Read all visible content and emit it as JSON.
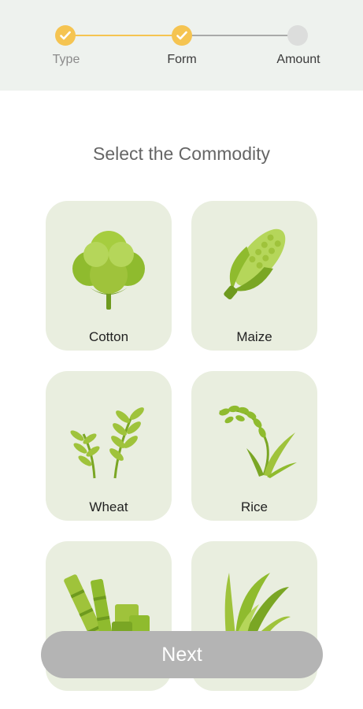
{
  "stepper": {
    "steps": [
      {
        "label": "Type",
        "status": "done"
      },
      {
        "label": "Form",
        "status": "done"
      },
      {
        "label": "Amount",
        "status": "pending"
      }
    ],
    "done_color": "#f5c451",
    "pending_color": "#dcdddc"
  },
  "page": {
    "title": "Select the Commodity"
  },
  "commodities": [
    {
      "label": "Cotton",
      "icon": "cotton-icon"
    },
    {
      "label": "Maize",
      "icon": "maize-icon"
    },
    {
      "label": "Wheat",
      "icon": "wheat-icon"
    },
    {
      "label": "Rice",
      "icon": "rice-icon"
    },
    {
      "label": "",
      "icon": "sugarcane-icon"
    },
    {
      "label": "",
      "icon": "grass-crop-icon"
    }
  ],
  "footer": {
    "next_label": "Next"
  },
  "colors": {
    "card_bg": "#e9eedf",
    "icon_green_light": "#9fc33b",
    "icon_green_dark": "#6e9a1e",
    "button_disabled": "#b4b4b4"
  }
}
